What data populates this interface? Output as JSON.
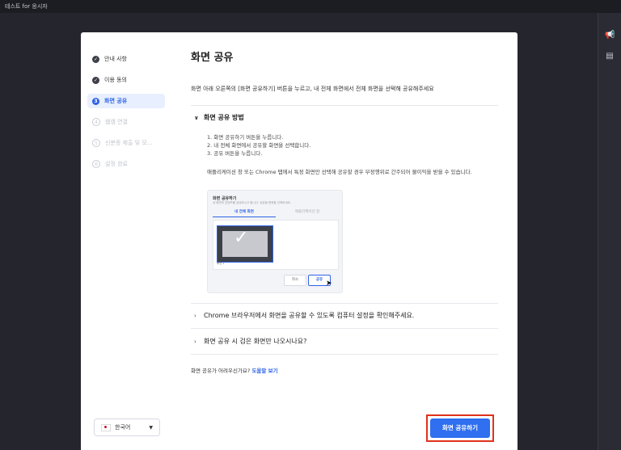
{
  "window": {
    "title": "테스트 for 응시자"
  },
  "sidebar": {
    "steps": [
      {
        "label": "안내 사항",
        "state": "done",
        "marker": "✓"
      },
      {
        "label": "이용 동의",
        "state": "done",
        "marker": "✓"
      },
      {
        "label": "화면 공유",
        "state": "active",
        "marker": "3"
      },
      {
        "label": "웹캠 연결",
        "state": "todo",
        "marker": "4"
      },
      {
        "label": "신분증 제출 및 모...",
        "state": "todo",
        "marker": "5"
      },
      {
        "label": "설정 완료",
        "state": "todo",
        "marker": "6"
      }
    ],
    "language": {
      "value": "한국어"
    }
  },
  "main": {
    "title": "화면 공유",
    "description": "화면 아래 오른쪽의 [화면 공유하기] 버튼을 누르고, 내 전체 화면에서 전체 화면을 선택해 공유해주세요",
    "section_method": {
      "label": "화면 공유 방법",
      "steps": [
        "1. 화면 공유하기 버튼을 누릅니다.",
        "2. 내 전체 화면에서 공유할 화면을 선택합니다.",
        "3. 공유 버튼을 누릅니다."
      ],
      "note": "애플리케이션 창 또는 Chrome 탭에서 특정 화면만 선택해 공유할 경우 부정행위로 간주되어 불이익을 받을 수 있습니다."
    },
    "preview": {
      "title": "화면 공유하기",
      "subtitle": "내 화면의 콘텐츠를 공유하시고 합니다. 공유할 항목을 선택하세요.",
      "tab_full": "내 전체 화면",
      "tab_app": "애플리케이션 창",
      "screen_label": "화면 1",
      "cancel": "취소",
      "share": "공유"
    },
    "section_chrome": {
      "label": "Chrome 브라우저에서 화면을 공유할 수 있도록 컴퓨터 설정을 확인해주세요."
    },
    "section_black": {
      "label": "화면 공유 시 검은 화면만 나오시나요?"
    },
    "help": {
      "text": "화면 공유가 어려우신가요?",
      "link": "도움말 보기"
    },
    "cta": "화면 공유하기"
  },
  "colors": {
    "accent": "#2f6ff0",
    "highlight": "#e0321c",
    "background": "#25262d"
  }
}
